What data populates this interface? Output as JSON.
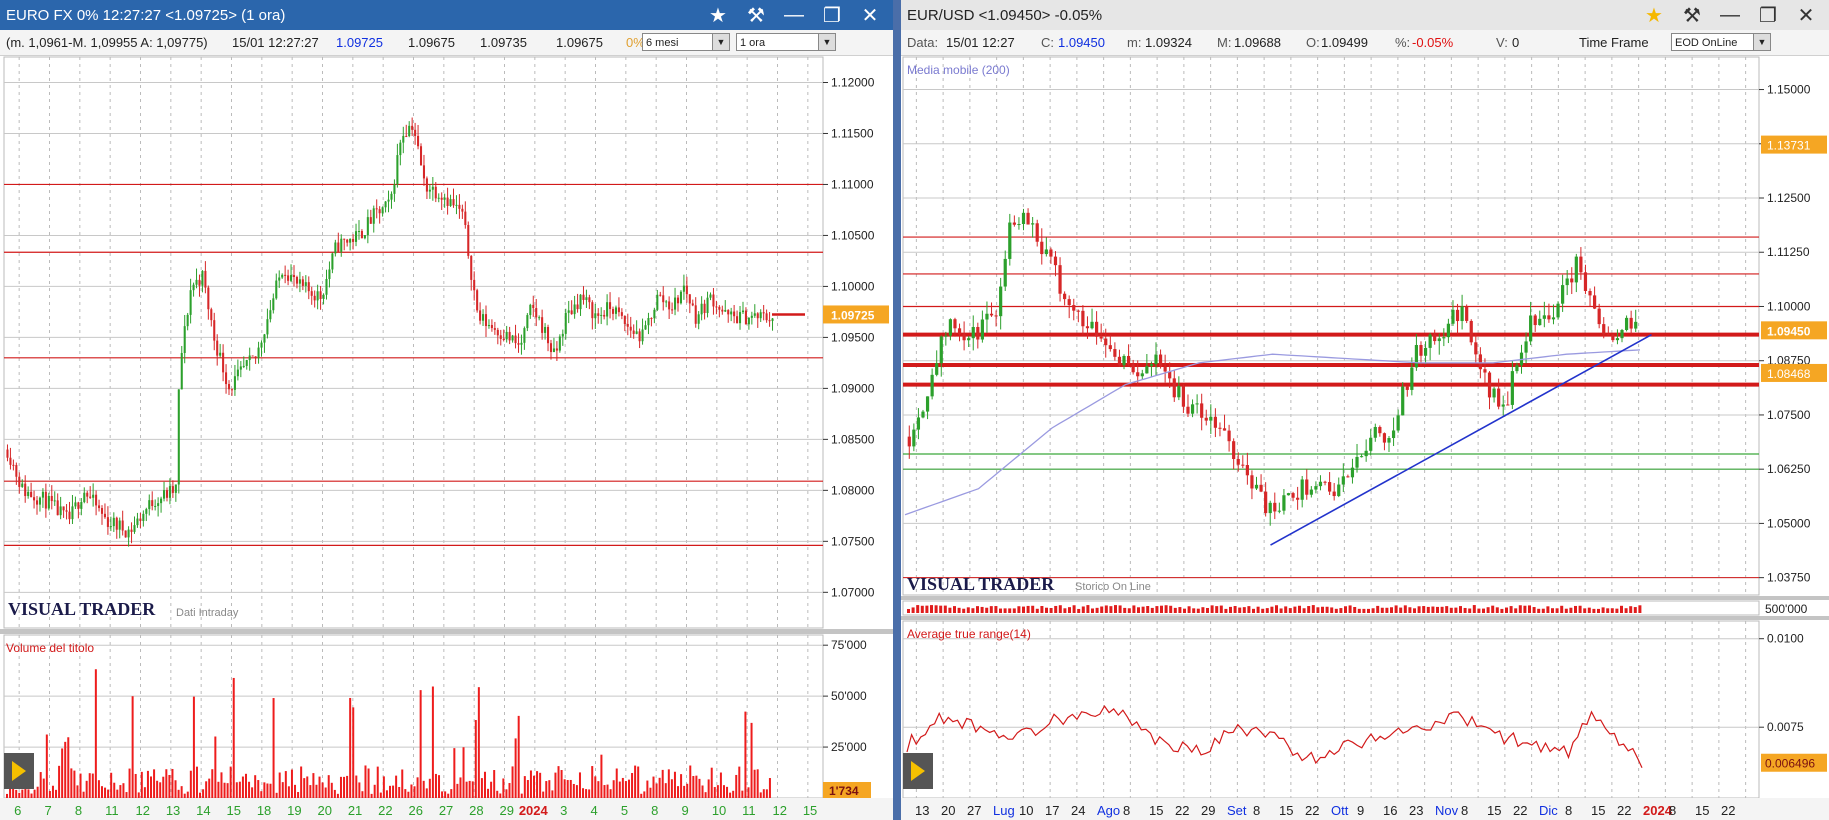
{
  "left": {
    "title": "EURO FX 0% 12:27:27  <1.09725> (1 ora)",
    "info": {
      "range": "(m. 1,0961-M. 1,09955 A: 1,09775)",
      "datetime": "15/01 12:27:27",
      "last": "1.09725",
      "v1": "1.09675",
      "v2": "1.09735",
      "v3": "1.09675",
      "v4": "0%"
    },
    "period_select": "6 mesi",
    "interval_select": "1 ora",
    "logo": "VISUAL TRADER",
    "logo_sub": "Dati Intraday",
    "volume_label": "Volume del titolo",
    "volume_badge": "1'734",
    "price_badge": "1.09725"
  },
  "right": {
    "title": "EUR/USD  <1.09450>  -0.05%",
    "info": {
      "data_label": "Data:",
      "data": "15/01 12:27",
      "c_label": "C:",
      "c": "1.09450",
      "m_label": "m:",
      "m": "1.09324",
      "M_label": "M:",
      "M": "1.09688",
      "o_label": "O:",
      "o": "1.09499",
      "pct_label": "%:",
      "pct": "-0.05%",
      "v_label": "V:",
      "v": "0",
      "tf_label": "Time Frame"
    },
    "tf_select": "EOD OnLine",
    "ma_label": "Media mobile (200)",
    "logo": "VISUAL TRADER",
    "logo_sub": "Storico On Line",
    "atr_label": "Average true range(14)",
    "vol_axis": "500'000",
    "badge_top": "1.13731",
    "badge_price": "1.09450",
    "badge_ma": "1.08468",
    "badge_atr": "0.006496"
  },
  "chart_data": [
    {
      "type": "candlestick",
      "title": "EURO FX 0% 12:27:27  <1.09725> (1 ora)",
      "ylim": [
        1.0665,
        1.1225
      ],
      "yticks": [
        "1.07000",
        "1.07500",
        "1.08000",
        "1.08500",
        "1.09000",
        "1.09500",
        "1.10000",
        "1.10500",
        "1.11000",
        "1.11500",
        "1.12000"
      ],
      "xticks": [
        "6",
        "7",
        "8",
        "11",
        "12",
        "13",
        "14",
        "15",
        "18",
        "19",
        "20",
        "21",
        "22",
        "26",
        "27",
        "28",
        "29",
        "2024",
        "3",
        "4",
        "5",
        "8",
        "9",
        "10",
        "11",
        "12",
        "15"
      ],
      "price_path": [
        [
          0,
          1.084
        ],
        [
          0.02,
          1.08
        ],
        [
          0.05,
          1.079
        ],
        [
          0.08,
          1.077
        ],
        [
          0.1,
          1.08
        ],
        [
          0.13,
          1.077
        ],
        [
          0.16,
          1.076
        ],
        [
          0.19,
          1.079
        ],
        [
          0.22,
          1.08
        ],
        [
          0.225,
          1.092
        ],
        [
          0.24,
          1.1
        ],
        [
          0.255,
          1.101
        ],
        [
          0.27,
          1.095
        ],
        [
          0.29,
          1.09
        ],
        [
          0.31,
          1.092
        ],
        [
          0.325,
          1.093
        ],
        [
          0.34,
          1.097
        ],
        [
          0.36,
          1.102
        ],
        [
          0.38,
          1.1
        ],
        [
          0.41,
          1.099
        ],
        [
          0.43,
          1.104
        ],
        [
          0.46,
          1.105
        ],
        [
          0.48,
          1.107
        ],
        [
          0.5,
          1.108
        ],
        [
          0.515,
          1.115
        ],
        [
          0.53,
          1.116
        ],
        [
          0.545,
          1.11
        ],
        [
          0.57,
          1.109
        ],
        [
          0.595,
          1.107
        ],
        [
          0.615,
          1.097
        ],
        [
          0.635,
          1.096
        ],
        [
          0.655,
          1.095
        ],
        [
          0.67,
          1.094
        ],
        [
          0.685,
          1.098
        ],
        [
          0.7,
          1.096
        ],
        [
          0.715,
          1.093
        ],
        [
          0.73,
          1.097
        ],
        [
          0.75,
          1.099
        ],
        [
          0.77,
          1.097
        ],
        [
          0.79,
          1.098
        ],
        [
          0.81,
          1.096
        ],
        [
          0.83,
          1.095
        ],
        [
          0.85,
          1.099
        ],
        [
          0.87,
          1.098
        ],
        [
          0.885,
          1.1
        ],
        [
          0.9,
          1.097
        ],
        [
          0.92,
          1.099
        ],
        [
          0.94,
          1.097
        ]
      ],
      "horizontal_lines": [
        1.11,
        1.10335,
        1.093,
        1.0809,
        1.0746
      ],
      "last_price": 1.09725
    },
    {
      "type": "bar",
      "title": "Volume del titolo",
      "ylim": [
        0,
        80000
      ],
      "yticks": [
        "25'000",
        "50'000",
        "75'000"
      ],
      "last_value": "1'734"
    },
    {
      "type": "candlestick",
      "title": "EUR/USD  <1.09450>  -0.05%",
      "ylim": [
        1.0335,
        1.1575
      ],
      "yticks": [
        "1.03750",
        "1.05000",
        "1.06250",
        "1.07500",
        "1.08750",
        "1.10000",
        "1.11250",
        "1.12500",
        "1.13750",
        "1.15000"
      ],
      "xticks": [
        "13",
        "20",
        "27",
        "Lug",
        "10",
        "17",
        "24",
        "Ago",
        "8",
        "15",
        "22",
        "29",
        "Set",
        "8",
        "15",
        "22",
        "Ott",
        "9",
        "16",
        "23",
        "Nov",
        "8",
        "15",
        "22",
        "Dic",
        "8",
        "15",
        "22",
        "2024",
        "8",
        "15",
        "22"
      ],
      "price_path": [
        [
          0,
          1.07
        ],
        [
          0.02,
          1.078
        ],
        [
          0.04,
          1.09
        ],
        [
          0.06,
          1.096
        ],
        [
          0.08,
          1.092
        ],
        [
          0.1,
          1.095
        ],
        [
          0.12,
          1.1
        ],
        [
          0.14,
          1.12
        ],
        [
          0.16,
          1.122
        ],
        [
          0.18,
          1.115
        ],
        [
          0.2,
          1.108
        ],
        [
          0.22,
          1.1
        ],
        [
          0.24,
          1.097
        ],
        [
          0.26,
          1.095
        ],
        [
          0.28,
          1.09
        ],
        [
          0.3,
          1.087
        ],
        [
          0.32,
          1.083
        ],
        [
          0.34,
          1.09
        ],
        [
          0.36,
          1.082
        ],
        [
          0.38,
          1.078
        ],
        [
          0.4,
          1.075
        ],
        [
          0.42,
          1.073
        ],
        [
          0.44,
          1.068
        ],
        [
          0.46,
          1.063
        ],
        [
          0.48,
          1.057
        ],
        [
          0.5,
          1.052
        ],
        [
          0.52,
          1.055
        ],
        [
          0.54,
          1.058
        ],
        [
          0.56,
          1.06
        ],
        [
          0.58,
          1.057
        ],
        [
          0.6,
          1.06
        ],
        [
          0.62,
          1.065
        ],
        [
          0.64,
          1.072
        ],
        [
          0.66,
          1.07
        ],
        [
          0.68,
          1.08
        ],
        [
          0.7,
          1.09
        ],
        [
          0.72,
          1.092
        ],
        [
          0.74,
          1.095
        ],
        [
          0.76,
          1.1
        ],
        [
          0.78,
          1.088
        ],
        [
          0.8,
          1.08
        ],
        [
          0.82,
          1.076
        ],
        [
          0.84,
          1.09
        ],
        [
          0.86,
          1.098
        ],
        [
          0.88,
          1.097
        ],
        [
          0.9,
          1.104
        ],
        [
          0.92,
          1.11
        ],
        [
          0.935,
          1.104
        ],
        [
          0.95,
          1.095
        ],
        [
          0.97,
          1.094
        ],
        [
          0.99,
          1.096
        ],
        [
          1.0,
          1.0945
        ]
      ],
      "horizontal_lines": [
        1.116,
        1.1075,
        1.1,
        1.0935,
        1.0865,
        1.082,
        1.066,
        1.0625
      ],
      "moving_average_200": [
        [
          0,
          1.052
        ],
        [
          0.1,
          1.058
        ],
        [
          0.2,
          1.072
        ],
        [
          0.3,
          1.082
        ],
        [
          0.4,
          1.087
        ],
        [
          0.5,
          1.089
        ],
        [
          0.6,
          1.088
        ],
        [
          0.7,
          1.087
        ],
        [
          0.8,
          1.087
        ],
        [
          0.9,
          1.089
        ],
        [
          1.0,
          1.09
        ]
      ],
      "trendline": [
        [
          0.5,
          1.045
        ],
        [
          1.1,
          1.095
        ]
      ],
      "last_price": 1.0945
    },
    {
      "type": "line",
      "title": "Average true range(14)",
      "ylim": [
        0.0055,
        0.0105
      ],
      "yticks": [
        "0.0075",
        "0.0100"
      ],
      "series": [
        [
          0,
          0.007
        ],
        [
          0.05,
          0.0078
        ],
        [
          0.1,
          0.0075
        ],
        [
          0.15,
          0.0072
        ],
        [
          0.2,
          0.0077
        ],
        [
          0.25,
          0.008
        ],
        [
          0.3,
          0.0078
        ],
        [
          0.35,
          0.007
        ],
        [
          0.4,
          0.0068
        ],
        [
          0.45,
          0.0075
        ],
        [
          0.5,
          0.0072
        ],
        [
          0.55,
          0.0066
        ],
        [
          0.6,
          0.007
        ],
        [
          0.65,
          0.0073
        ],
        [
          0.7,
          0.0075
        ],
        [
          0.75,
          0.0078
        ],
        [
          0.8,
          0.0073
        ],
        [
          0.85,
          0.007
        ],
        [
          0.9,
          0.0068
        ],
        [
          0.93,
          0.0078
        ],
        [
          0.96,
          0.0072
        ],
        [
          1.0,
          0.0065
        ]
      ],
      "last_value": "0.006496"
    }
  ]
}
